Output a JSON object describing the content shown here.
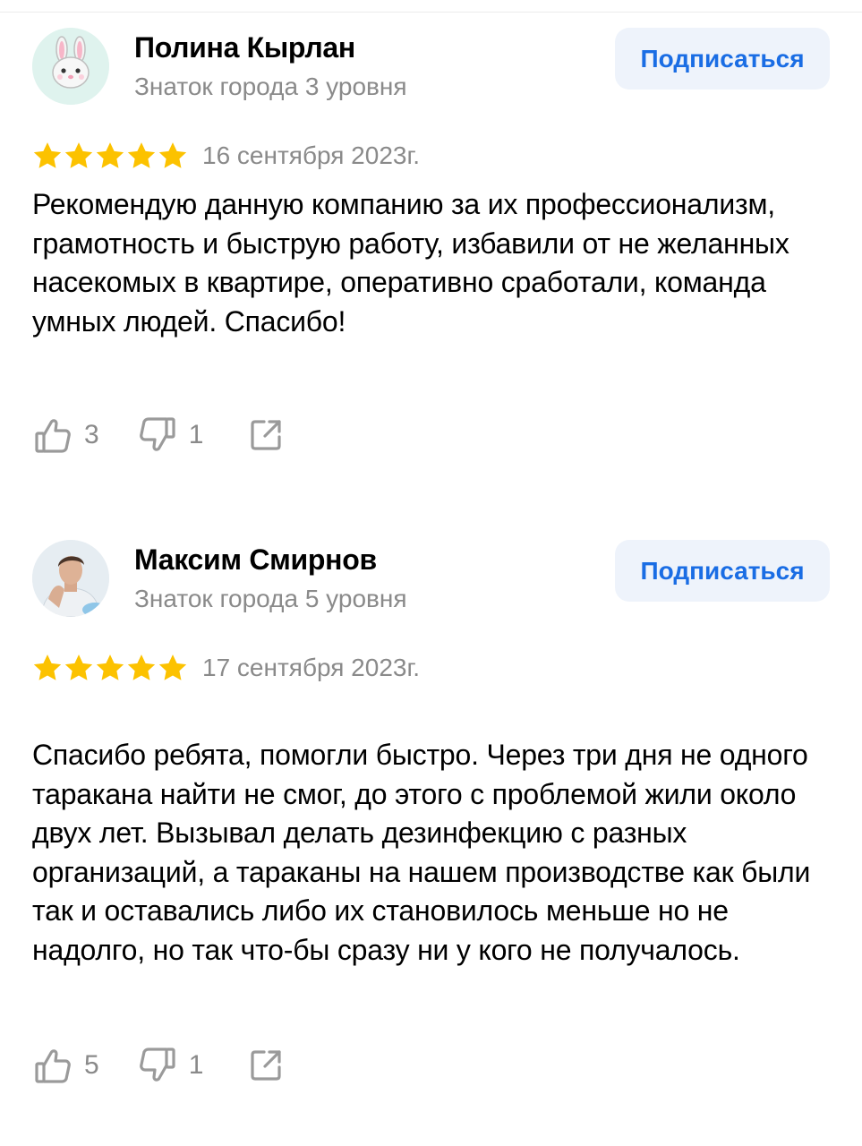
{
  "reviews": [
    {
      "author": "Полина Кырлан",
      "level": "Знаток города 3 уровня",
      "subscribe_label": "Подписаться",
      "rating": 5,
      "date": "16 сентября 2023г.",
      "text": "Рекомендую данную компанию за их профессионализм, грамотность и быструю работу, избавили от не желанных насекомых в квартире, оперативно сработали, команда умных людей. Спасибо!",
      "likes": "3",
      "dislikes": "1",
      "avatar_icon": "rabbit-face-icon"
    },
    {
      "author": "Максим Смирнов",
      "level": "Знаток города 5 уровня",
      "subscribe_label": "Подписаться",
      "rating": 5,
      "date": "17 сентября 2023г.",
      "text": "Спасибо ребята, помогли быстро. Через три дня не одного таракана найти не смог, до этого с проблемой жили около двух лет. Вызывал делать дезинфекцию с разных организаций, а тараканы на нашем производстве как были так и оставались либо их становилось меньше но не надолго, но так что-бы сразу ни у кого не получалось.",
      "likes": "5",
      "dislikes": "1",
      "avatar_icon": "person-photo"
    }
  ],
  "colors": {
    "star": "#fcc200",
    "accent": "#1a6de4",
    "button_bg": "#eef3fb",
    "muted": "#8a8a8a",
    "icon_gray": "#9a9a9a"
  },
  "icons": [
    "thumbs-up-icon",
    "thumbs-down-icon",
    "share-icon",
    "star-icon"
  ]
}
